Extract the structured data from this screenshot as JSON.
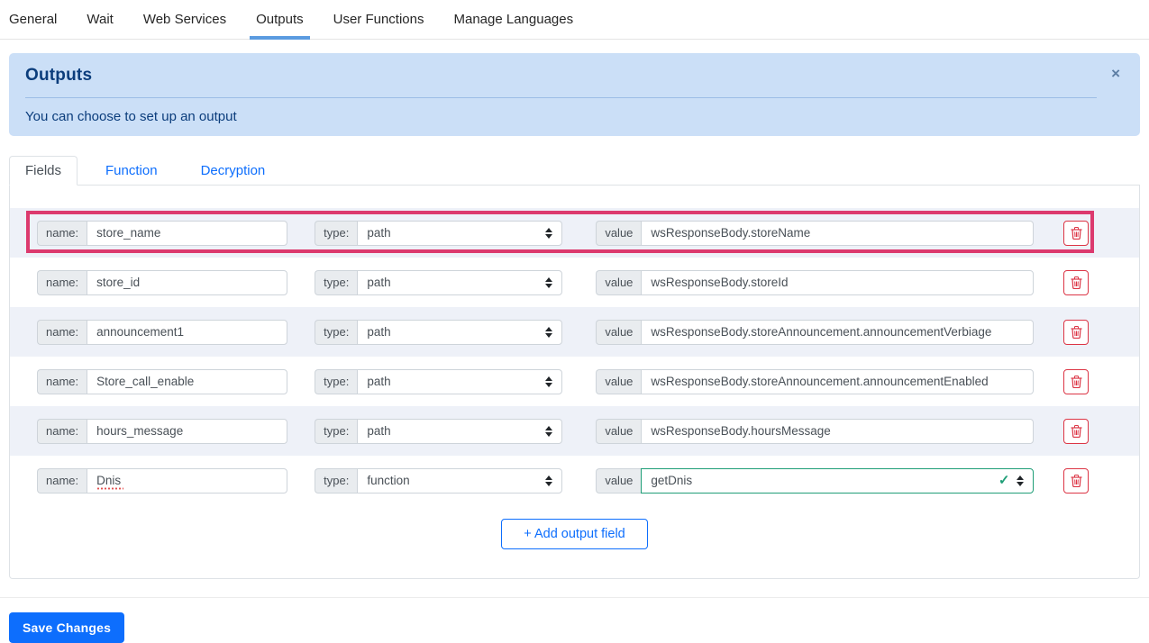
{
  "top_nav": {
    "items": [
      {
        "label": "General",
        "active": false
      },
      {
        "label": "Wait",
        "active": false
      },
      {
        "label": "Web Services",
        "active": false
      },
      {
        "label": "Outputs",
        "active": true
      },
      {
        "label": "User Functions",
        "active": false
      },
      {
        "label": "Manage Languages",
        "active": false
      }
    ]
  },
  "alert": {
    "title": "Outputs",
    "message": "You can choose to set up an output",
    "close_label": "×"
  },
  "tabs": {
    "items": [
      {
        "label": "Fields",
        "active": true
      },
      {
        "label": "Function",
        "active": false
      },
      {
        "label": "Decryption",
        "active": false
      }
    ]
  },
  "fields": {
    "name_label": "name:",
    "type_label": "type:",
    "value_label": "value",
    "rows": [
      {
        "name": "store_name",
        "type": "path",
        "value": "wsResponseBody.storeName",
        "highlighted": true
      },
      {
        "name": "store_id",
        "type": "path",
        "value": "wsResponseBody.storeId",
        "highlighted": false
      },
      {
        "name": "announcement1",
        "type": "path",
        "value": "wsResponseBody.storeAnnouncement.announcementVerbiage",
        "highlighted": false
      },
      {
        "name": "Store_call_enable",
        "type": "path",
        "value": "wsResponseBody.storeAnnouncement.announcementEnabled",
        "highlighted": false
      },
      {
        "name": "hours_message",
        "type": "path",
        "value": "wsResponseBody.hoursMessage",
        "highlighted": false
      },
      {
        "name": "Dnis",
        "type": "function",
        "value": "getDnis",
        "highlighted": false,
        "value_valid": true
      }
    ],
    "add_button_label": "+ Add output field"
  },
  "footer": {
    "save_button_label": "Save Changes"
  },
  "colors": {
    "accent": "#0d6efd",
    "nav_underline": "#5b9be0",
    "highlight_border": "#dc3a6e",
    "danger": "#dc3545",
    "success": "#1f9e77",
    "alert_bg": "#cbdff7",
    "alert_text": "#0b3d7c",
    "stripe_bg": "#eef1f8"
  }
}
